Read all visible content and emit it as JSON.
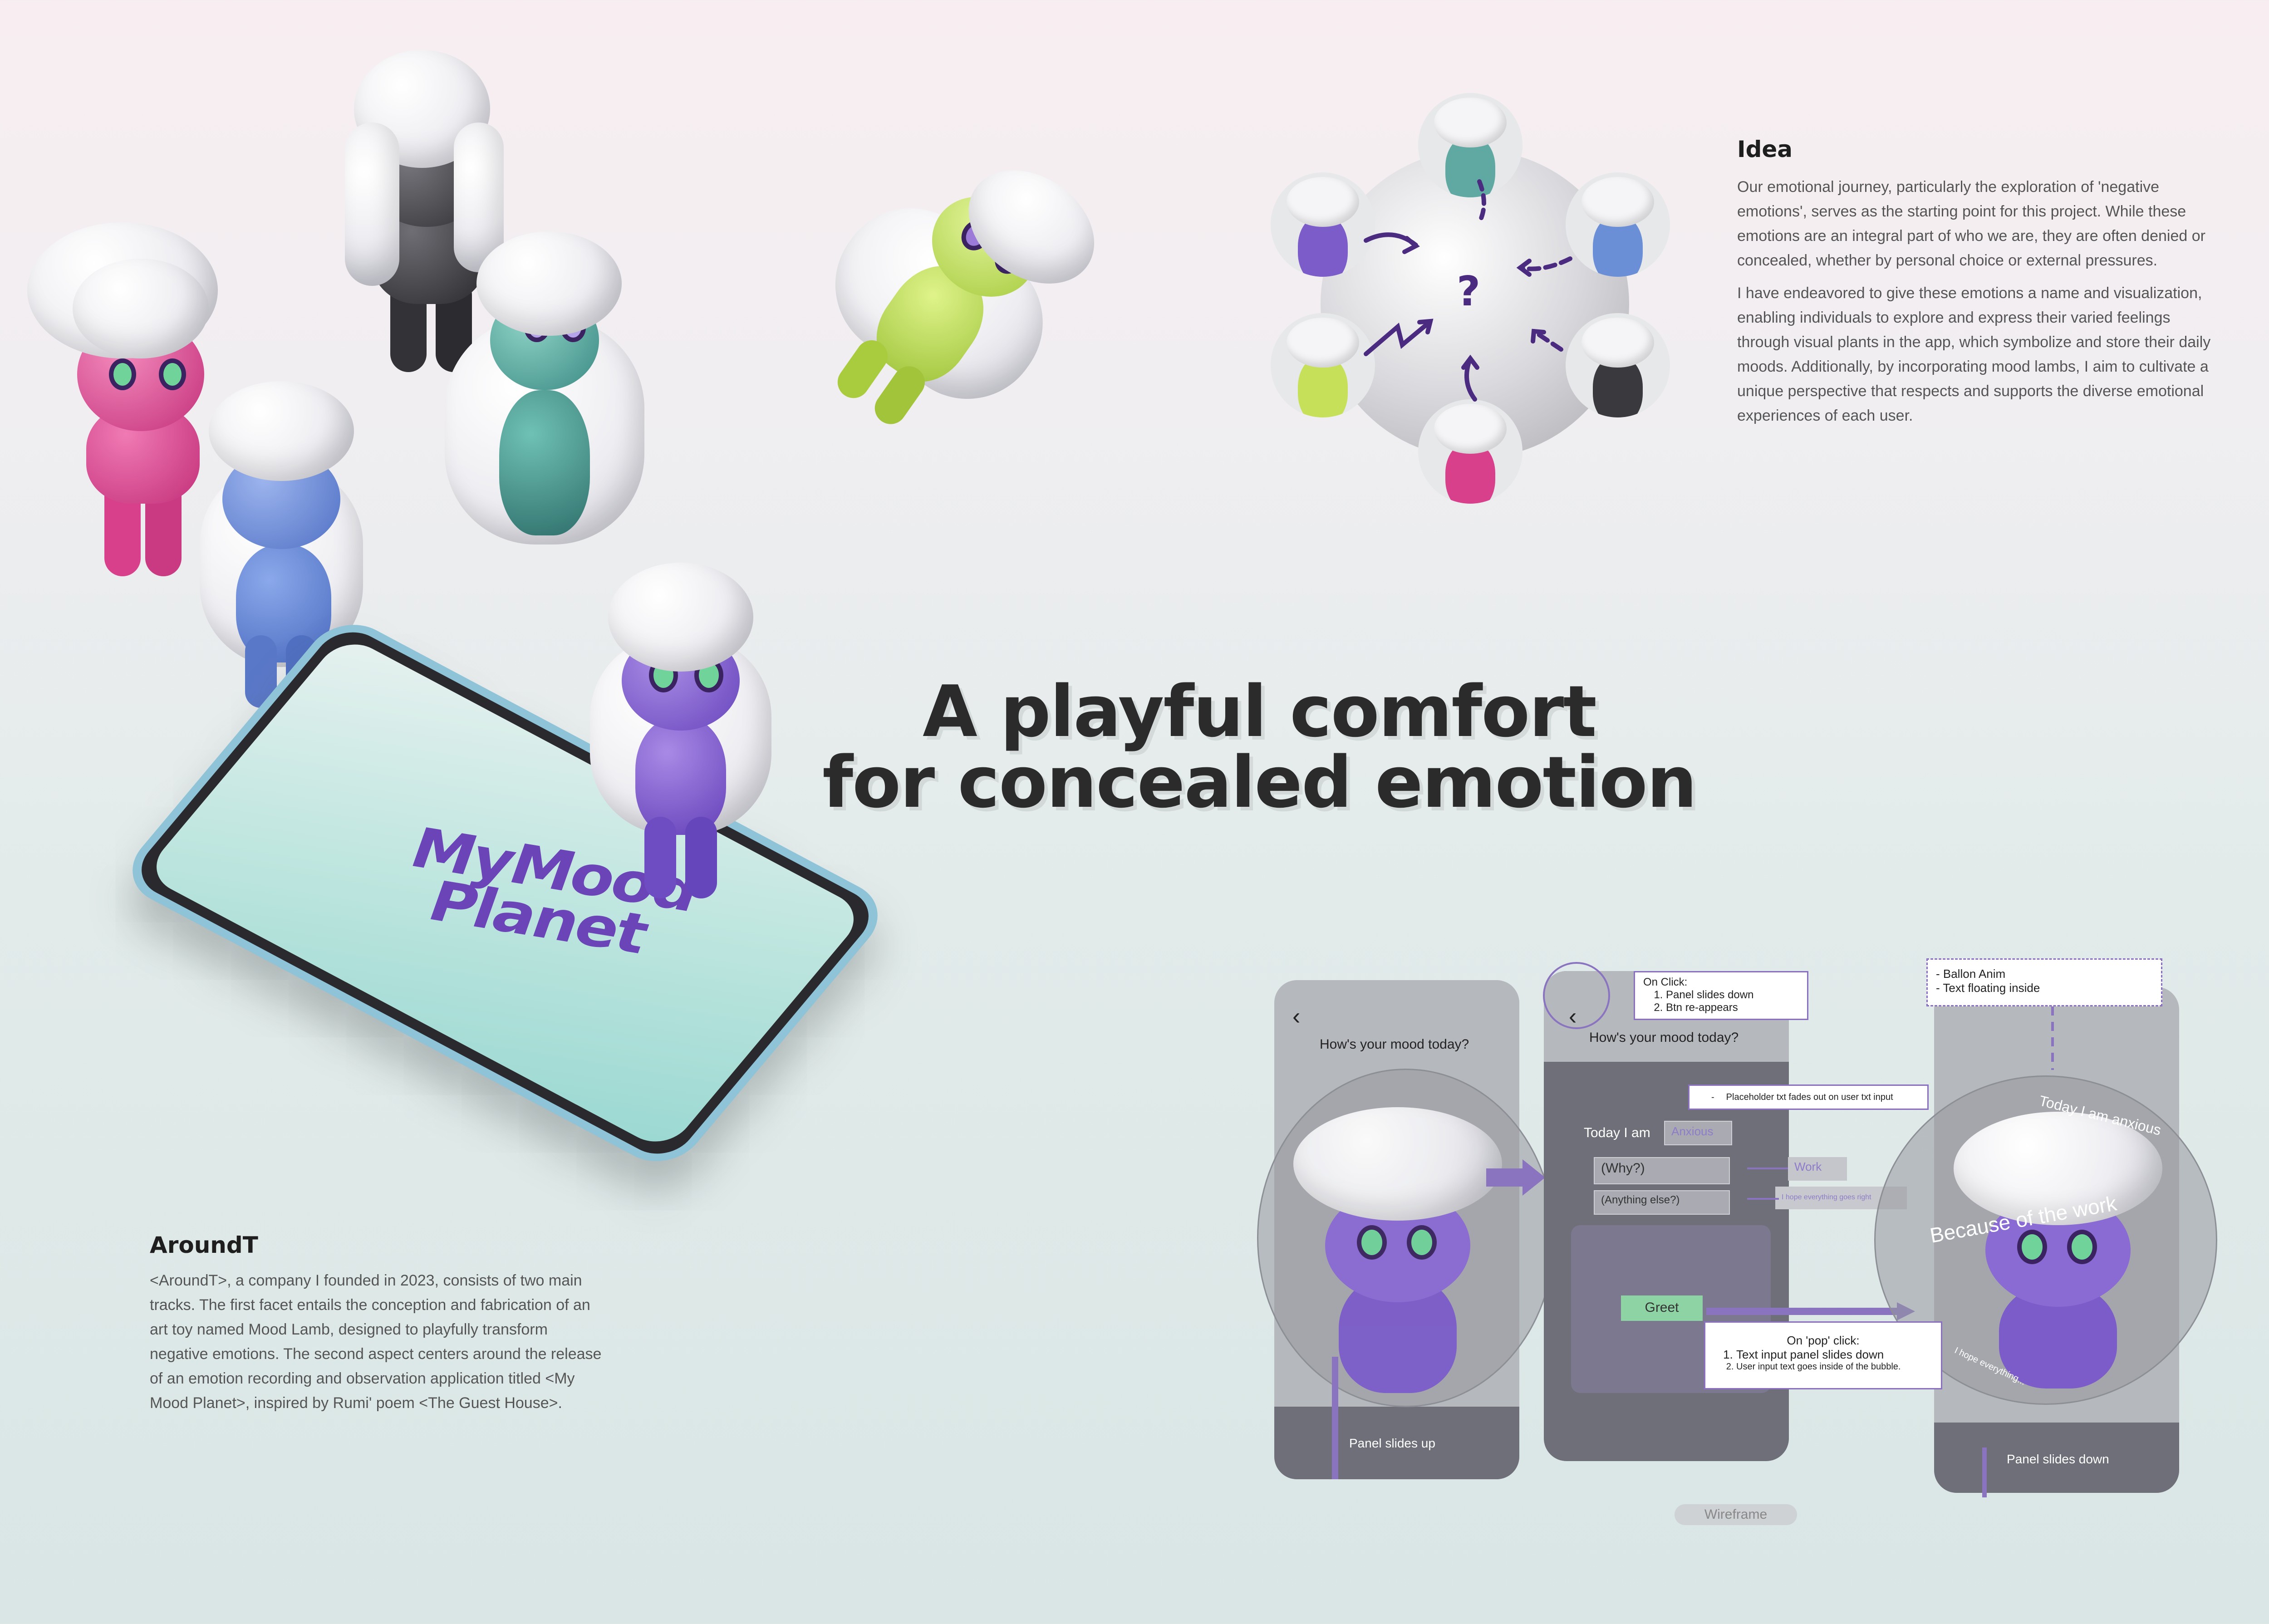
{
  "headline": {
    "line1": "A playful comfort",
    "line2": "for concealed emotion"
  },
  "phone": {
    "logo_line1": "MyMood",
    "logo_line2": "Planet"
  },
  "idea": {
    "title": "Idea",
    "paragraph1": " Our emotional journey, particularly the exploration of 'negative emotions', serves as the starting point for this project. While these emotions are an integral part of who we are, they are often denied or concealed, whether by personal choice or external pressures.",
    "paragraph2": "I have endeavored to give these emotions a name and visualization, enabling individuals to explore and express their varied feelings through visual plants in the app, which symbolize and store their daily moods. Additionally, by incorporating mood lambs, I aim to cultivate a unique perspective that respects and supports the diverse emotional experiences of each user.",
    "center_symbol": "?"
  },
  "aroundt": {
    "title": "AroundT",
    "paragraph": " <AroundT>, a company I founded in 2023, consists of two main tracks. The first facet entails the conception and fabrication of an art toy named Mood Lamb, designed to playfully transform negative emotions. The second aspect centers around the release of an emotion recording and observation application titled <My Mood Planet>, inspired by Rumi' poem <The Guest House>."
  },
  "wireframe": {
    "label": "Wireframe",
    "screen1": {
      "question": "How's your mood today?",
      "caption": "Panel slides up"
    },
    "screen2": {
      "question": "How's your mood today?",
      "today_label": "Today I am",
      "mood_value": "Anxious",
      "why_field": "(Why?)",
      "anything_field": "(Anything else?)",
      "work_hint": "Work",
      "hope_hint": "I hope everything goes right",
      "greet_button": "Greet"
    },
    "screen3": {
      "bubble_text1": "Today I am anxious",
      "bubble_text2": "Because of the work",
      "bubble_text3": "I hope everything...",
      "caption": "Panel slides down"
    },
    "note_onclick": {
      "title": "On Click:",
      "items": [
        "Panel slides down",
        "Btn re-appears"
      ]
    },
    "note_placeholder": {
      "bullet": "-",
      "text": "Placeholder txt fades out on user txt input"
    },
    "note_balloon": {
      "items": [
        "- Ballon Anim",
        "- Text floating inside"
      ]
    },
    "note_pop": {
      "title": "On 'pop' click:",
      "items": [
        "Text input panel slides down",
        "User input text goes inside of the bubble."
      ]
    }
  },
  "colors": {
    "purple_lamb": "#7b5cc9",
    "pink_lamb": "#d9408c",
    "blue_lamb": "#6b8fd6",
    "teal_lamb": "#3f8f8a",
    "black_lamb": "#3a3a3e",
    "lime_lamb": "#b9dc4a",
    "accent": "#8a74c0"
  }
}
